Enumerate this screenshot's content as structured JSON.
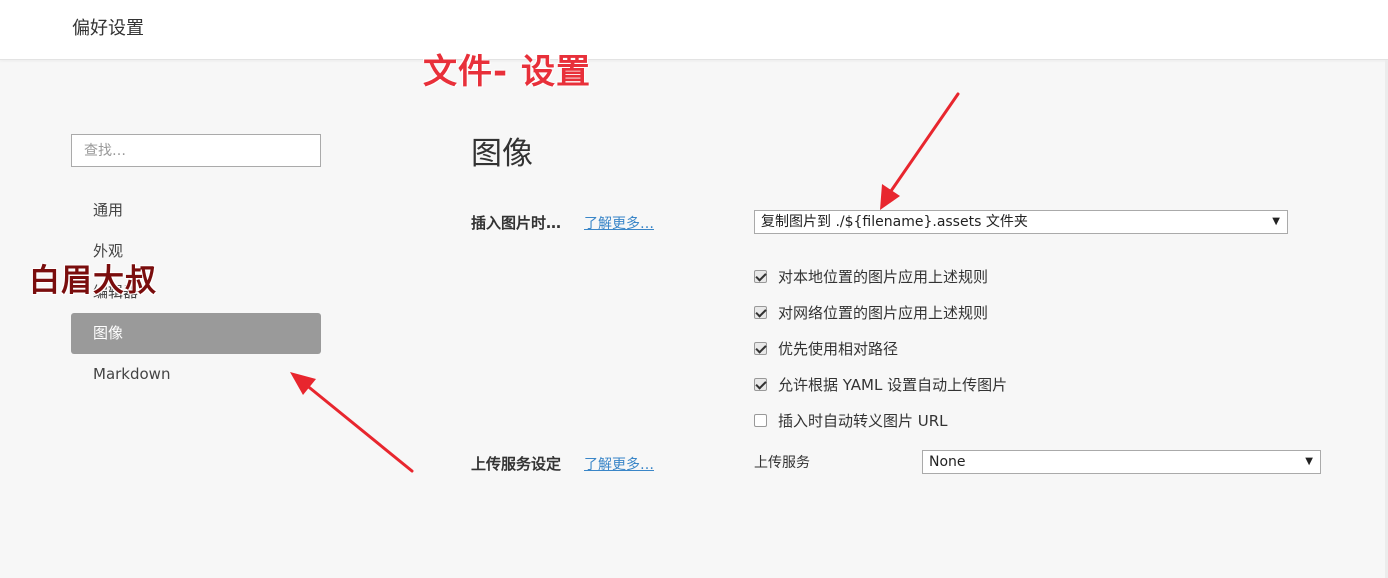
{
  "window": {
    "title": "偏好设置"
  },
  "sidebar": {
    "search_placeholder": "查找…",
    "items": [
      {
        "label": "通用",
        "active": false
      },
      {
        "label": "外观",
        "active": false
      },
      {
        "label": "编辑器",
        "active": false
      },
      {
        "label": "图像",
        "active": true
      },
      {
        "label": "Markdown",
        "active": false
      }
    ]
  },
  "main": {
    "title": "图像",
    "insert_image": {
      "label": "插入图片时…",
      "learn_more": "了解更多…",
      "selected_option": "复制图片到 ./${filename}.assets 文件夹"
    },
    "options": [
      {
        "label": "对本地位置的图片应用上述规则",
        "checked": true
      },
      {
        "label": "对网络位置的图片应用上述规则",
        "checked": true
      },
      {
        "label": "优先使用相对路径",
        "checked": true
      },
      {
        "label": "允许根据 YAML 设置自动上传图片",
        "checked": true
      },
      {
        "label": "插入时自动转义图片 URL",
        "checked": false
      }
    ],
    "upload": {
      "label": "上传服务设定",
      "learn_more": "了解更多…",
      "service_label": "上传服务",
      "selected_option": "None"
    }
  },
  "annotations": {
    "file_settings": "文件- 设置",
    "watermark": "白眉大叔",
    "arrow_color": "#e8262e"
  },
  "colors": {
    "active_nav_bg": "#9a9a9a",
    "link": "#3a86c8"
  }
}
